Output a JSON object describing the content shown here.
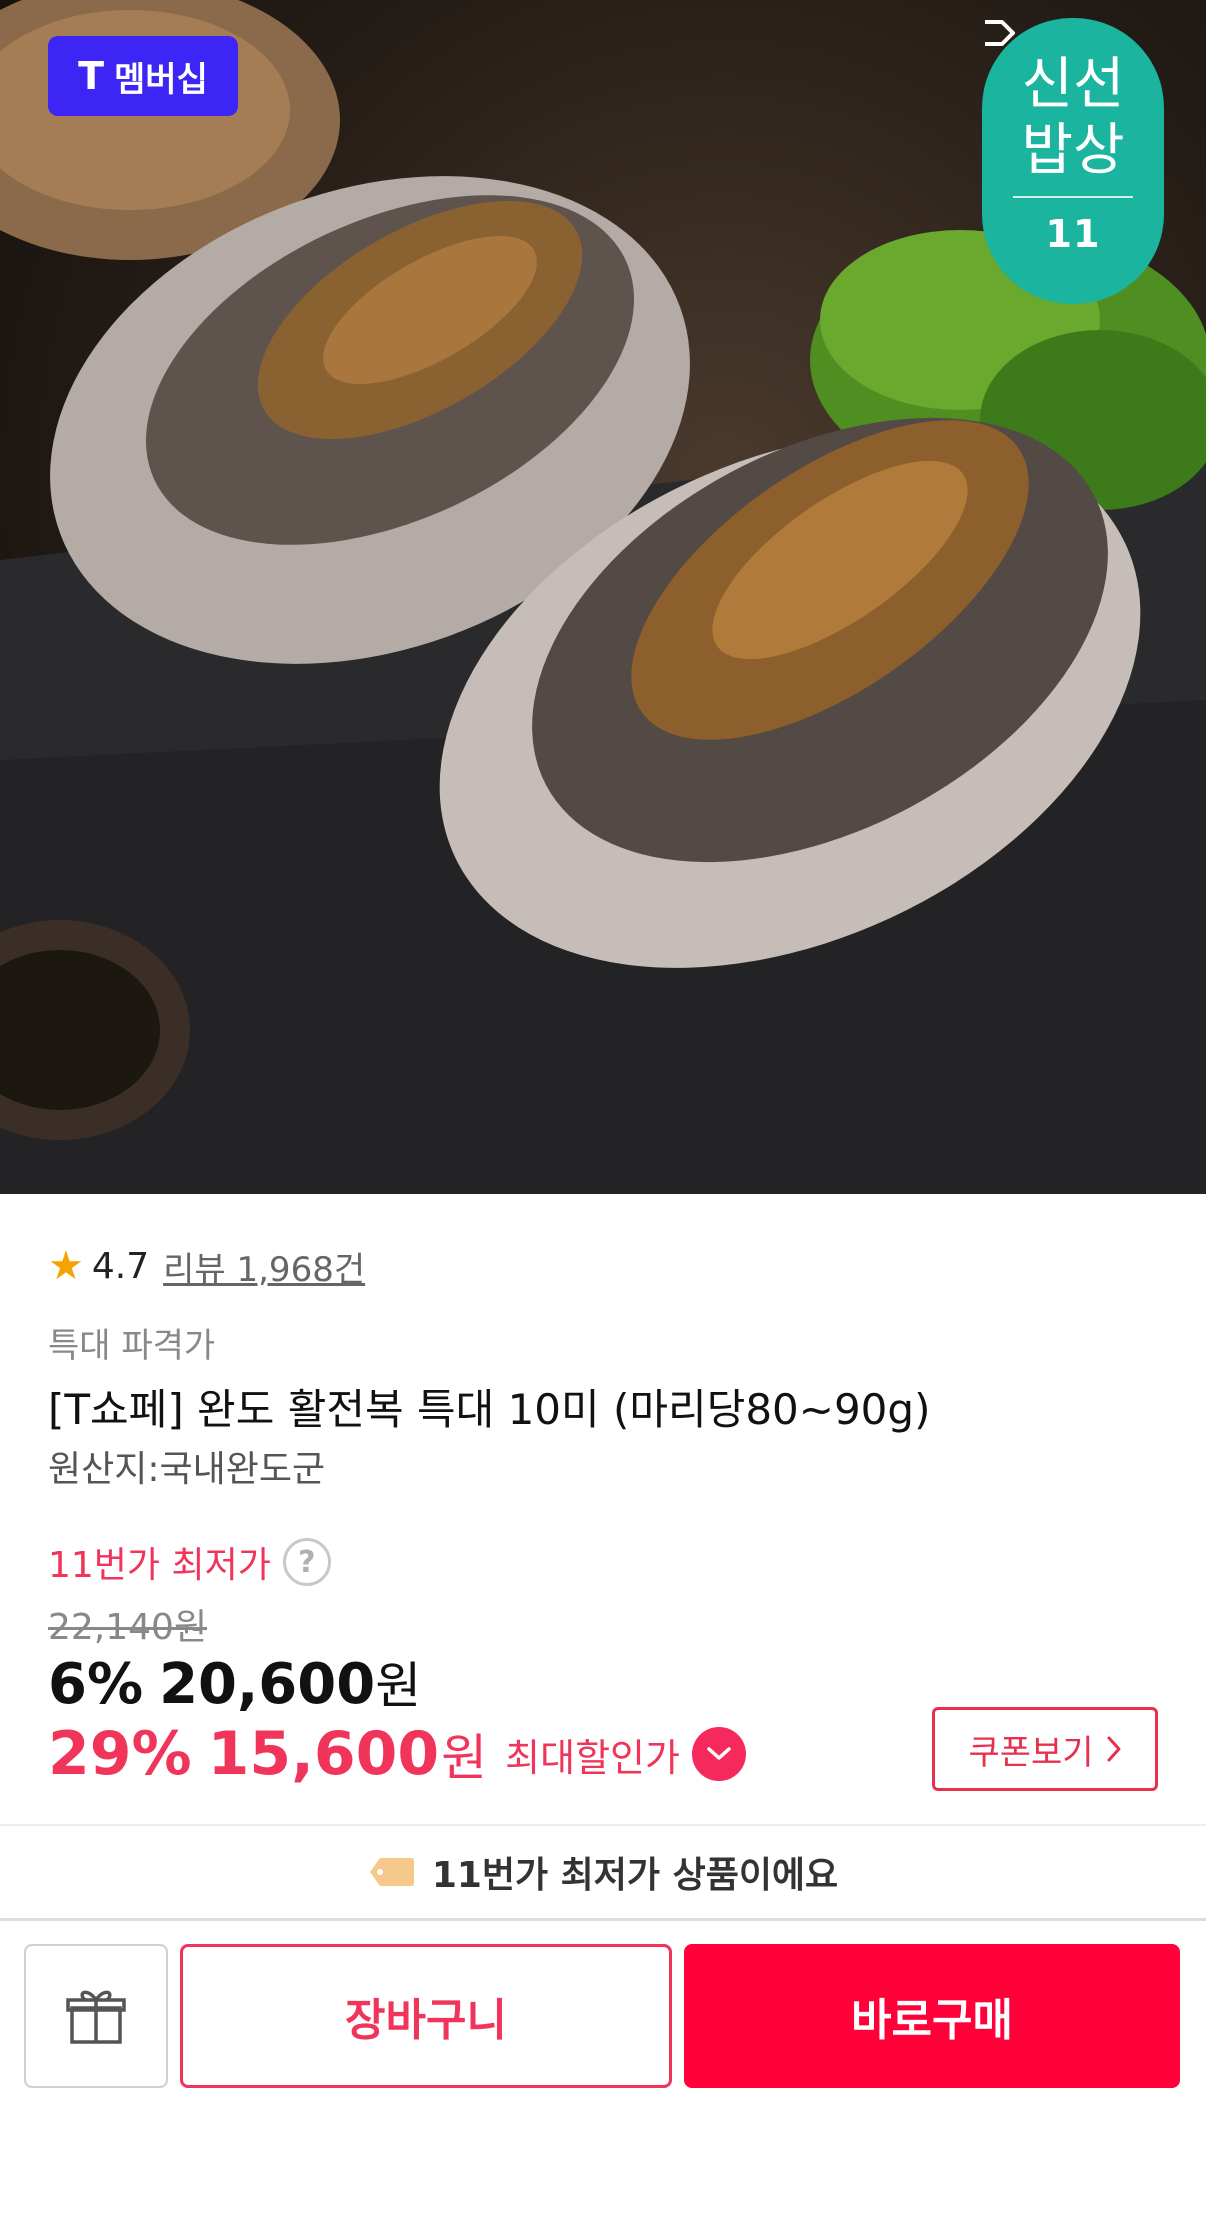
{
  "hero": {
    "tmember_badge": {
      "mark": "T",
      "label": "멤버십"
    },
    "fresh_badge": {
      "line1": "신선",
      "line2": "밥상",
      "brand": "11"
    }
  },
  "rating": {
    "score": "4.7",
    "reviews": "리뷰 1,968건"
  },
  "product": {
    "subtitle": "특대 파격가",
    "title": "[T쇼페] 완도 활전복 특대 10미 (마리당80~90g)",
    "origin": "원산지:국내완도군"
  },
  "price": {
    "lowest_label": "11번가 최저가",
    "help_glyph": "?",
    "original": "22,140원",
    "sale_percent": "6%",
    "sale_price": "20,600",
    "currency": "원",
    "max_percent": "29%",
    "max_price": "15,600",
    "max_label": "최대할인가"
  },
  "coupon": {
    "label": "쿠폰보기"
  },
  "banner": {
    "text": "11번가 최저가 상품이에요"
  },
  "actions": {
    "cart": "장바구니",
    "buy": "바로구매"
  },
  "colors": {
    "accent": "#f0345a",
    "buy": "#ff0038",
    "tmember": "#3d25f5",
    "fresh": "#1bb59f",
    "star": "#f5a300"
  }
}
